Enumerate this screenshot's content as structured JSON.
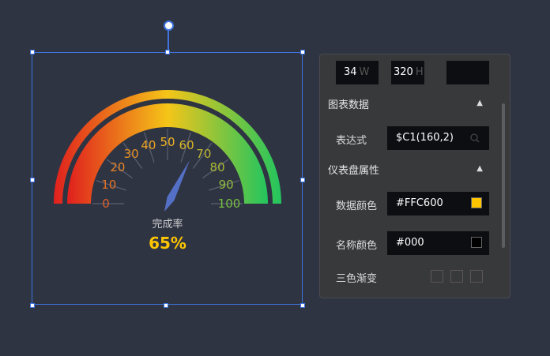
{
  "gauge": {
    "value": 65,
    "min": 0,
    "max": 100,
    "ticks": [
      "0",
      "10",
      "20",
      "30",
      "40",
      "50",
      "60",
      "70",
      "80",
      "90",
      "100"
    ],
    "name": "完成率",
    "value_text": "65%",
    "value_color": "#FFC600",
    "needle_color": "#5470c6",
    "gradient": [
      "#e0201e",
      "#f5c518",
      "#22c55e"
    ]
  },
  "panel": {
    "width_value": "34",
    "width_unit": "W",
    "height_value": "320",
    "height_unit": "H",
    "section_chart_data": "图表数据",
    "expression_label": "表达式",
    "expression_value": "$C1(160,2)",
    "section_gauge_props": "仪表盘属性",
    "data_color_label": "数据颜色",
    "data_color_value": "#FFC600",
    "name_color_label": "名称颜色",
    "name_color_value": "#000",
    "tri_gradient_label": "三色渐变"
  }
}
